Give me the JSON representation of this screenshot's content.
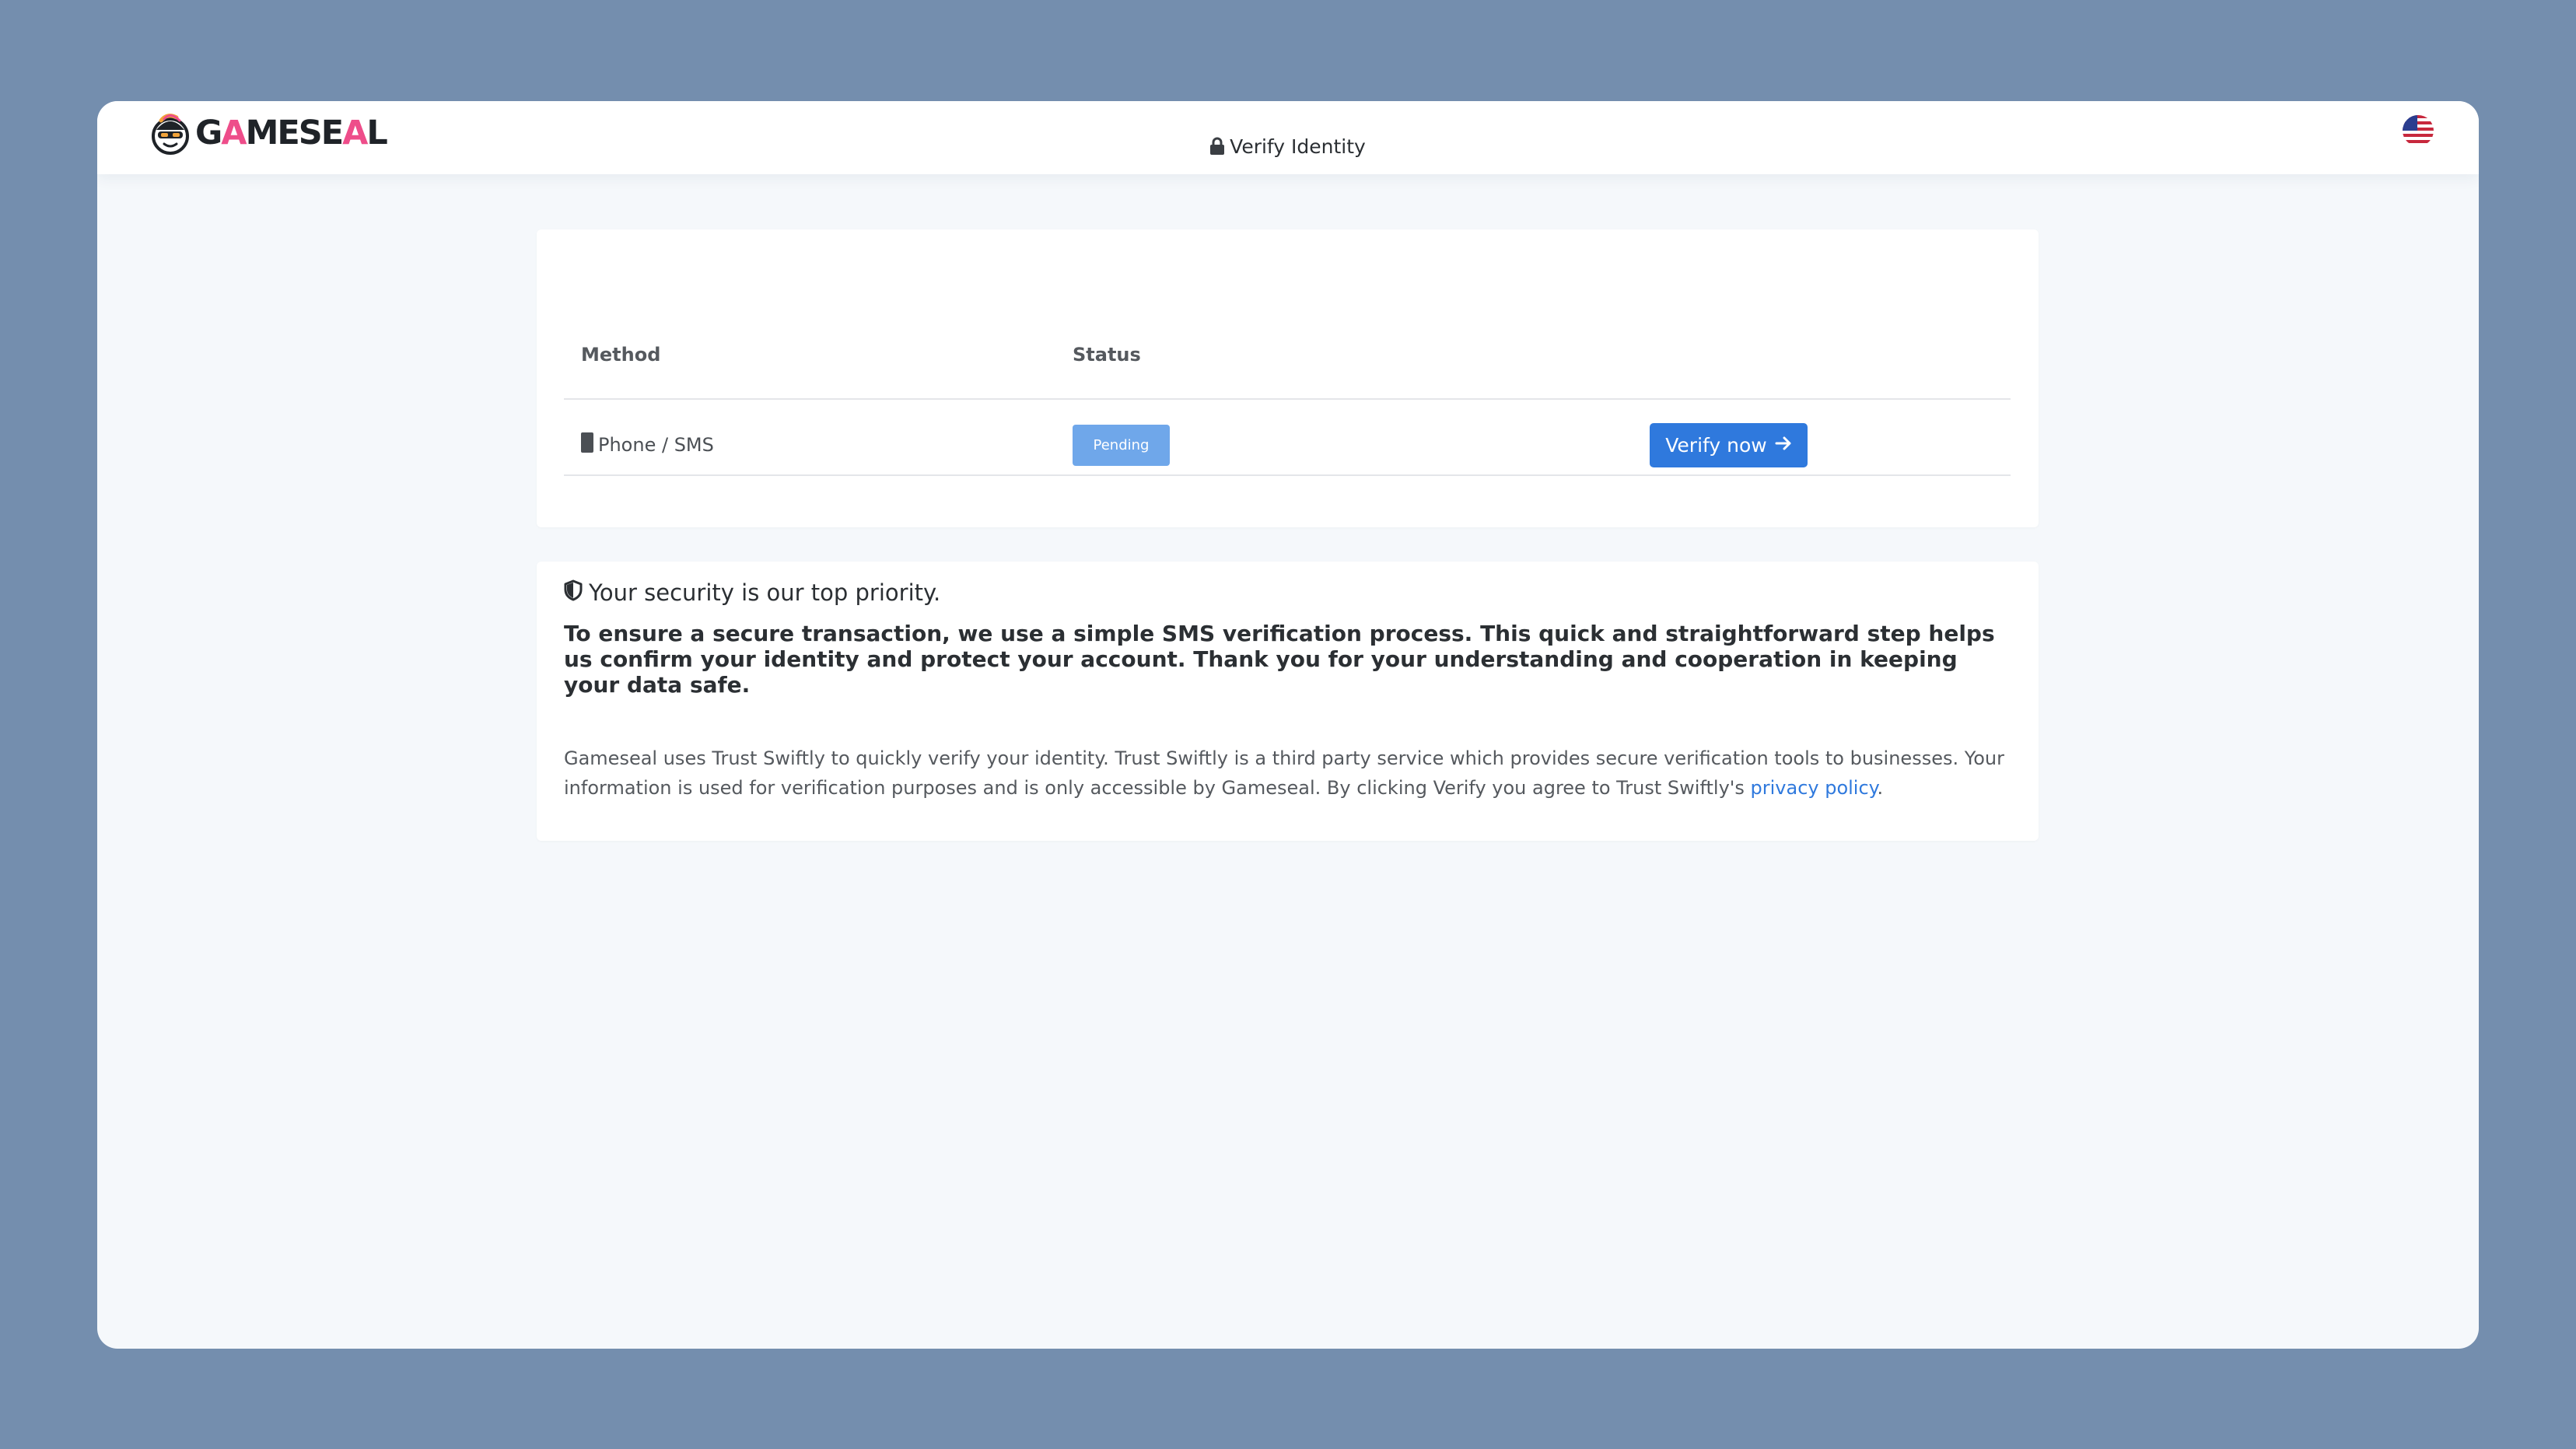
{
  "header": {
    "logo_text_part1": "G",
    "logo_text_accent1": "A",
    "logo_text_part2": "MESE",
    "logo_text_accent2": "A",
    "logo_text_part3": "L",
    "language_icon": "us-flag-icon"
  },
  "verify_card": {
    "title": "Verify Identity",
    "title_icon": "lock-icon",
    "columns": [
      "Method",
      "Status"
    ],
    "rows": [
      {
        "method_icon": "phone-icon",
        "method": "Phone / SMS",
        "status": "Pending",
        "action_label": "Verify now",
        "action_icon": "arrow-right-icon"
      }
    ]
  },
  "security_card": {
    "heading_icon": "shield-icon",
    "heading": "Your security is our top priority.",
    "intro": "To ensure a secure transaction, we use a simple SMS verification process. This quick and straightforward step helps us confirm your identity and protect your account. Thank you for your understanding and cooperation in keeping your data safe.",
    "disclaimer": "Gameseal uses Trust Swiftly to quickly verify your identity. Trust Swiftly is a third party service which provides secure verification tools to businesses. Your information is used for verification purposes and is only accessible by Gameseal. By clicking Verify you agree to Trust Swiftly's",
    "privacy_link": "privacy policy",
    "trailing_period": "."
  },
  "colors": {
    "page_background": "#748eae",
    "window_background": "#f5f8fb",
    "accent_blue": "#2f79dd",
    "pending_badge": "#6fa7ea",
    "logo_accent": "#ee4d8a"
  }
}
